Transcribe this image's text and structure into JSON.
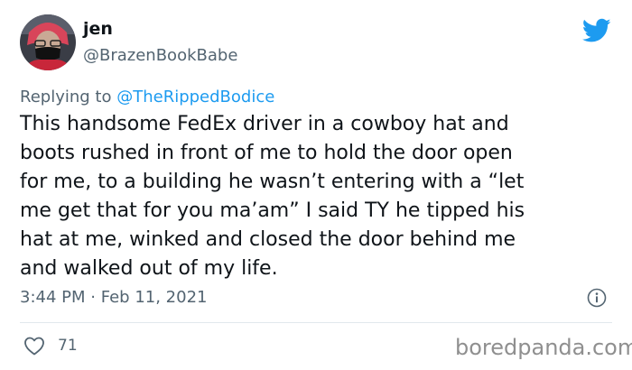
{
  "author": {
    "name": "jen",
    "handle": "@BrazenBookBabe",
    "avatar_icon": "user-avatar-photo"
  },
  "reply": {
    "prefix": "Replying to",
    "target": "@TheRippedBodice"
  },
  "tweet": {
    "lines": [
      "This handsome FedEx driver in a cowboy hat and",
      "boots rushed in front of me to hold the door open",
      "for me, to a building he wasn’t entering with a “let",
      "me get that for you ma’am” I said TY he tipped his",
      "hat at me, winked and closed the door behind me",
      "and walked out of my life."
    ]
  },
  "meta": {
    "time": "3:44 PM",
    "separator": "·",
    "date": "Feb 11, 2021"
  },
  "engagement": {
    "likes": "71"
  },
  "icons": {
    "brand": "twitter-bird-icon",
    "info": "info-icon",
    "like": "heart-icon"
  },
  "colors": {
    "twitter_blue": "#1d9bf0",
    "text": "#0f1419",
    "secondary": "#536471",
    "divider": "#e1e8ed"
  },
  "watermark": "boredpanda.com"
}
